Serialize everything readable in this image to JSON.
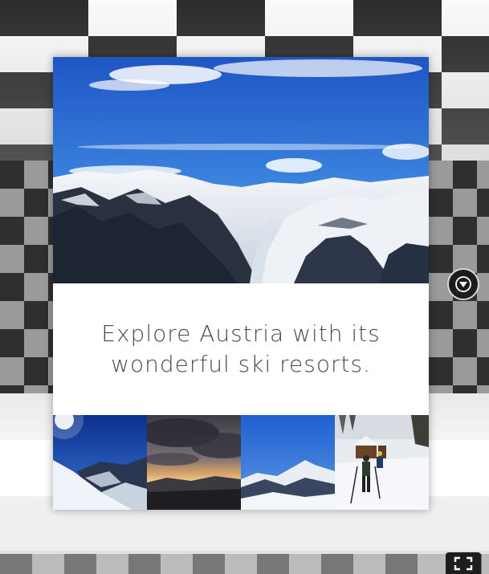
{
  "caption": {
    "line1": "Explore Austria with its",
    "line2": "wonderful ski resorts."
  },
  "hero_image": {
    "subject": "snowy alpine mountain valley under blue sky"
  },
  "thumbnails": [
    {
      "subject": "sunlit snow slope under deep blue sky"
    },
    {
      "subject": "cloudy sunset over mountain valley"
    },
    {
      "subject": "snowy mountain peaks and blue sky"
    },
    {
      "subject": "ski tourers walking past a wooden hut"
    }
  ],
  "controls": {
    "nav_icon": "compass-icon",
    "fullscreen_icon": "fullscreen-icon"
  },
  "colors": {
    "caption_text": "#4a4a4a",
    "card_background": "#ffffff",
    "sky_blue": "#2f6fd1"
  }
}
